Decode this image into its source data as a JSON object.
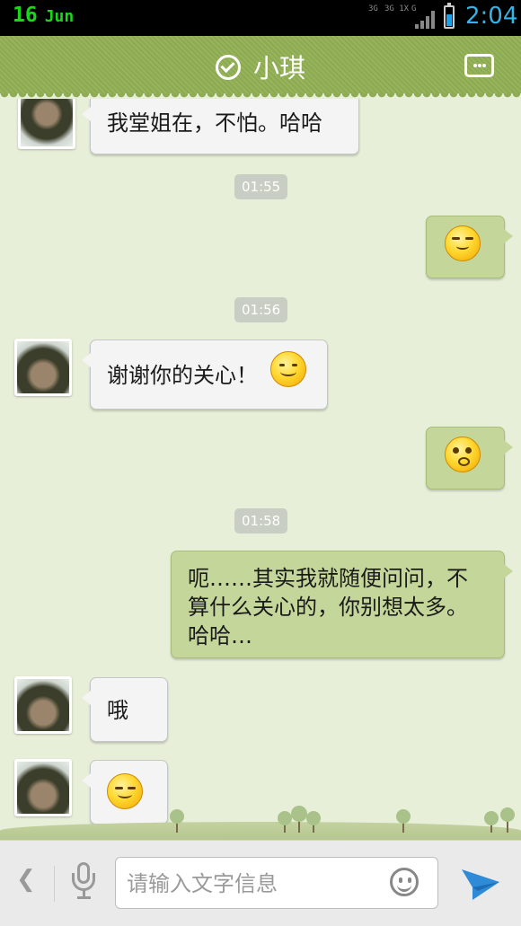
{
  "status_bar": {
    "date_day": "16",
    "date_month": "Jun",
    "network_1": "3G",
    "network_2": "3G 1X",
    "network_3": "G",
    "time": "2:04",
    "clock_color": "#33b5e5",
    "date_color": "#18d818"
  },
  "header": {
    "title": "小琪",
    "verified_icon": "check-circle-icon",
    "menu_icon": "more-dots-icon",
    "background_color": "#8daa52"
  },
  "messages": [
    {
      "type": "received",
      "text": "我堂姐在，不怕。哈哈"
    },
    {
      "type": "timestamp",
      "text": "01:55"
    },
    {
      "type": "sent",
      "emoji": "smug-face-emoji"
    },
    {
      "type": "timestamp",
      "text": "01:56"
    },
    {
      "type": "received",
      "text": "谢谢你的关心！",
      "emoji": "smile-emoji"
    },
    {
      "type": "sent",
      "emoji": "surprised-face-emoji"
    },
    {
      "type": "timestamp",
      "text": "01:58"
    },
    {
      "type": "sent",
      "text": "呃……其实我就随便问问，不算什么关心的，你别想太多。哈哈…"
    },
    {
      "type": "received",
      "text": "哦"
    },
    {
      "type": "received",
      "emoji": "content-face-emoji"
    }
  ],
  "input_bar": {
    "placeholder": "请输入文字信息",
    "back_icon": "chevron-left-icon",
    "voice_icon": "microphone-icon",
    "emoji_icon": "smiley-icon",
    "send_icon": "send-plane-icon",
    "send_color": "#2f8bd8"
  }
}
